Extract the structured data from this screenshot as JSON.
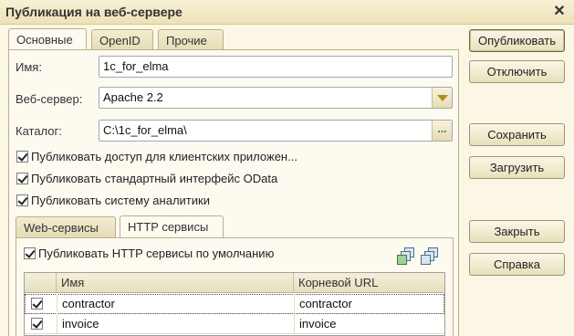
{
  "window": {
    "title": "Публикация на веб-сервере"
  },
  "tabs": [
    {
      "label": "Основные"
    },
    {
      "label": "OpenID"
    },
    {
      "label": "Прочие"
    }
  ],
  "form": {
    "name_label": "Имя:",
    "name_value": "1c_for_elma",
    "webserver_label": "Веб-сервер:",
    "webserver_value": "Apache 2.2",
    "catalog_label": "Каталог:",
    "catalog_value": "C:\\1c_for_elma\\",
    "catalog_button": "..."
  },
  "checkboxes": [
    {
      "label": "Публиковать доступ для клиентских приложен...",
      "checked": true
    },
    {
      "label": "Публиковать стандартный интерфейс OData",
      "checked": true
    },
    {
      "label": "Публиковать систему аналитики",
      "checked": true
    }
  ],
  "subtabs": [
    {
      "label": "Web-сервисы"
    },
    {
      "label": "HTTP сервисы"
    }
  ],
  "http": {
    "default_publish_label": "Публиковать HTTP сервисы по умолчанию",
    "default_publish_checked": true,
    "table": {
      "columns": [
        "Имя",
        "Корневой URL"
      ],
      "rows": [
        {
          "checked": true,
          "name": "contractor",
          "url": "contractor"
        },
        {
          "checked": true,
          "name": "invoice",
          "url": "invoice"
        }
      ]
    }
  },
  "buttons": {
    "publish": "Опубликовать",
    "disable": "Отключить",
    "save": "Сохранить",
    "load": "Загрузить",
    "close": "Закрыть",
    "help": "Справка"
  }
}
